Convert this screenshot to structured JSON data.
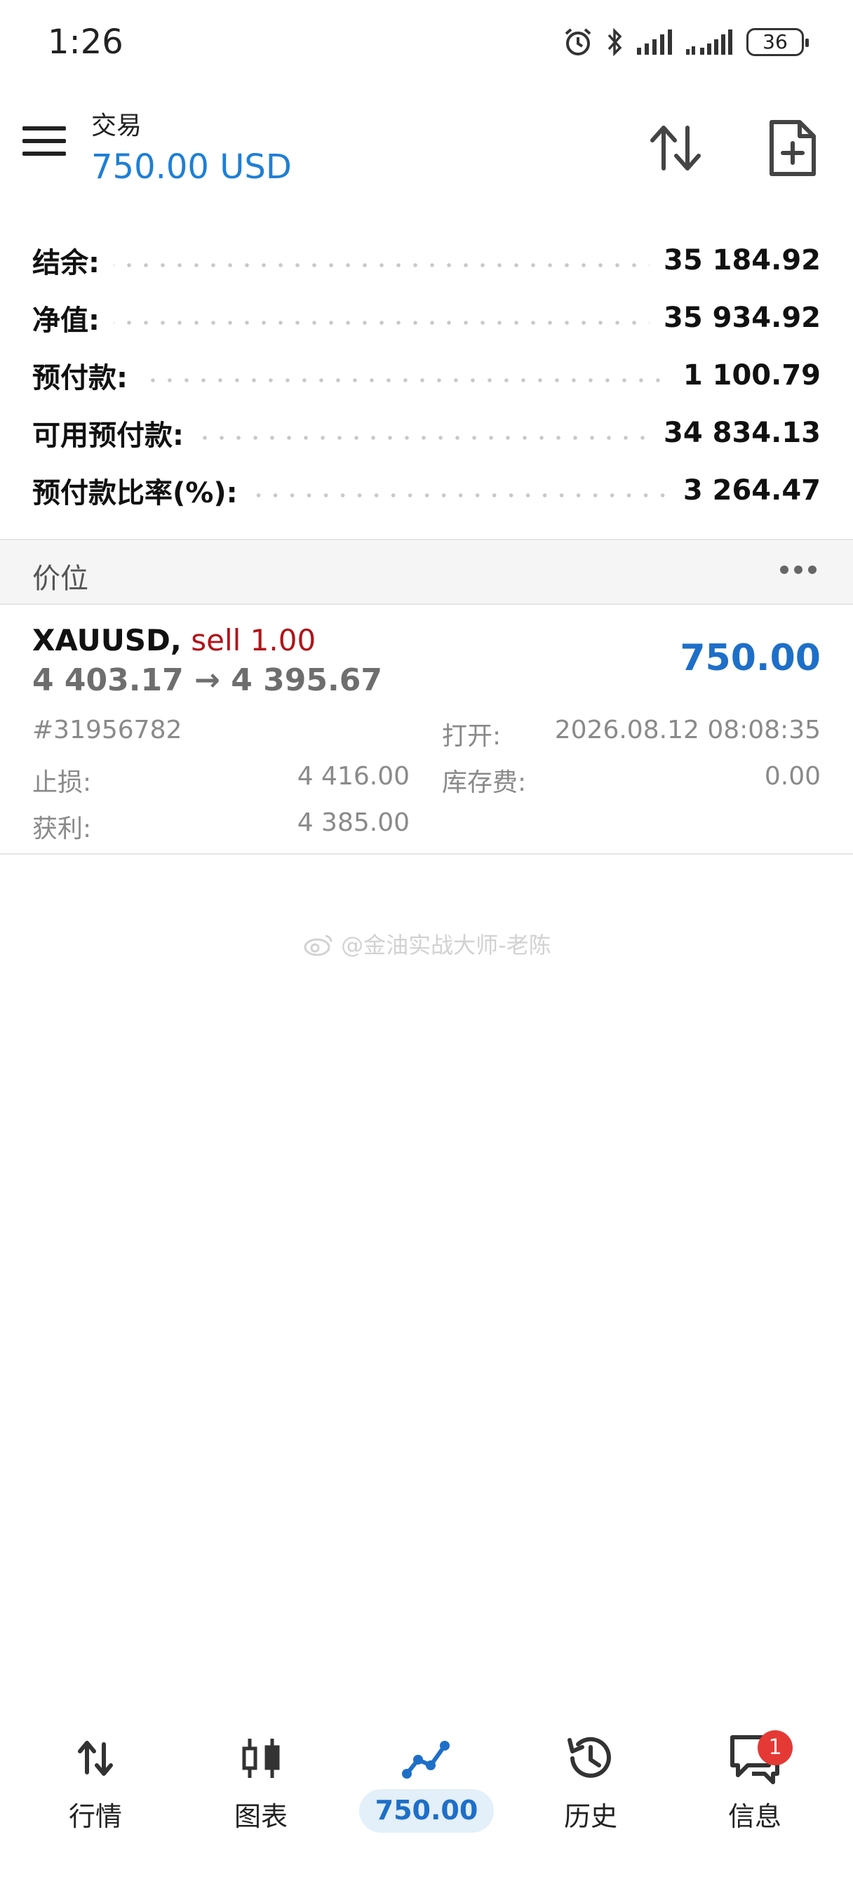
{
  "status_bar": {
    "time": "1:26",
    "battery": "36",
    "icons": [
      "alarm-icon",
      "bluetooth-icon",
      "signal-icon",
      "signal-icon"
    ]
  },
  "header": {
    "title": "交易",
    "profit": "750.00 USD",
    "icons": [
      "menu-icon",
      "sort-icon",
      "new-order-icon"
    ]
  },
  "summary": [
    {
      "label": "结余:",
      "value": "35 184.92"
    },
    {
      "label": "净值:",
      "value": "35 934.92"
    },
    {
      "label": "预付款:",
      "value": "1 100.79"
    },
    {
      "label": "可用预付款:",
      "value": "34 834.13"
    },
    {
      "label": "预付款比率(%):",
      "value": "3 264.47"
    }
  ],
  "section": {
    "title": "价位"
  },
  "position": {
    "symbol": "XAUUSD,",
    "side": "sell 1.00",
    "prices": "4 403.17 → 4 395.67",
    "profit": "750.00",
    "ticket": "#31956782",
    "open_label": "打开:",
    "open_time": "2026.08.12 08:08:35",
    "sl_label": "止损:",
    "sl_value": "4 416.00",
    "swap_label": "库存费:",
    "swap_value": "0.00",
    "tp_label": "获利:",
    "tp_value": "4 385.00"
  },
  "watermark": "@金油实战大师-老陈",
  "colors": {
    "accent": "#1e7fd6",
    "sell": "#b0141a",
    "badge": "#e53935"
  },
  "bottom_nav": [
    {
      "label": "行情",
      "icon": "quotes-icon"
    },
    {
      "label": "图表",
      "icon": "chart-icon"
    },
    {
      "label": "750.00",
      "icon": "trade-icon",
      "active": true
    },
    {
      "label": "历史",
      "icon": "history-icon"
    },
    {
      "label": "信息",
      "icon": "messages-icon",
      "badge": "1"
    }
  ]
}
